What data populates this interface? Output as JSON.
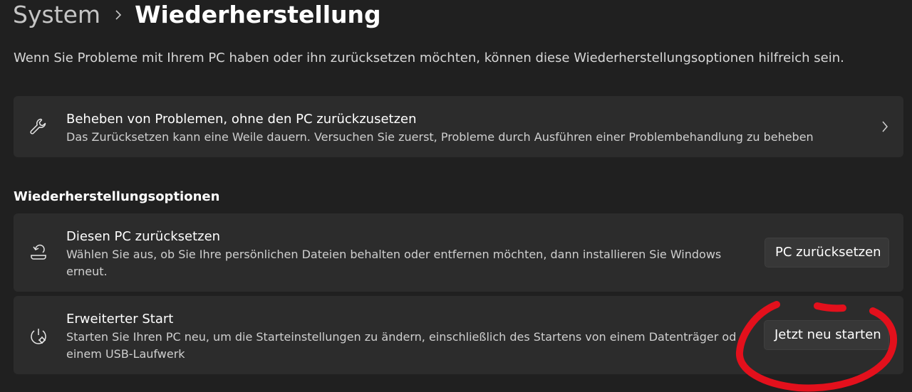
{
  "header": {
    "breadcrumb_parent": "System",
    "breadcrumb_current": "Wiederherstellung"
  },
  "intro": "Wenn Sie Probleme mit Ihrem PC haben oder ihn zurücksetzen möchten, können diese Wiederherstellungsoptionen hilfreich sein.",
  "troubleshoot_card": {
    "icon": "wrench-icon",
    "title": "Beheben von Problemen, ohne den PC zurückzusetzen",
    "description": "Das Zurücksetzen kann eine Weile dauern. Versuchen Sie zuerst, Probleme durch Ausführen einer Problembehandlung zu beheben"
  },
  "recovery_section": {
    "title": "Wiederherstellungsoptionen",
    "reset": {
      "icon": "reset-pc-icon",
      "title": "Diesen PC zurücksetzen",
      "description_line1": "Wählen Sie aus, ob Sie Ihre persönlichen Dateien behalten oder entfernen möchten, dann installieren Sie Windows",
      "description_line2": "erneut.",
      "button_label": "PC zurücksetzen"
    },
    "advanced_startup": {
      "icon": "advanced-startup-icon",
      "title": "Erweiterter Start",
      "description_line1": "Starten Sie Ihren PC neu, um die Starteinstellungen zu ändern, einschließlich des Startens von einem Datenträger oder",
      "description_line2": "einem USB-Laufwerk",
      "button_label": "Jetzt neu starten"
    }
  },
  "annotation": {
    "color": "#e3101c"
  },
  "colors": {
    "background": "#202020",
    "card": "#2c2c2c",
    "button": "#373737"
  }
}
